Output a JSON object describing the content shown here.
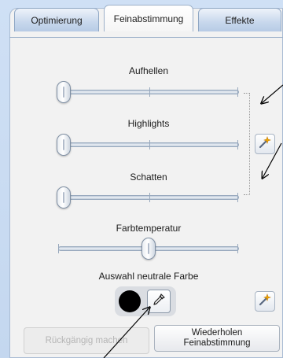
{
  "tabs": [
    {
      "label": "Optimierung",
      "active": false
    },
    {
      "label": "Feinabstimmung",
      "active": true
    },
    {
      "label": "Effekte",
      "active": false
    }
  ],
  "sliders": {
    "aufhellen": {
      "label": "Aufhellen",
      "value_percent": 0
    },
    "highlights": {
      "label": "Highlights",
      "value_percent": 0
    },
    "schatten": {
      "label": "Schatten",
      "value_percent": 0
    },
    "farbtemperatur": {
      "label": "Farbtemperatur",
      "value_percent": 50
    }
  },
  "neutral_color": {
    "label": "Auswahl neutrale Farbe",
    "swatch_color": "#000000"
  },
  "buttons": {
    "undo_label": "Rückgängig machen",
    "redo_label_line1": "Wiederholen",
    "redo_label_line2": "Feinabstimmung"
  },
  "icons": {
    "auto_fix_lighting": "magic-wand-icon",
    "auto_fix_color": "magic-wand-icon",
    "eyedropper": "eyedropper-icon"
  },
  "colors": {
    "tab_bar": "#2b6fd0",
    "panel_background": "#f2f2f2",
    "annotation_arrow": "#000000"
  }
}
